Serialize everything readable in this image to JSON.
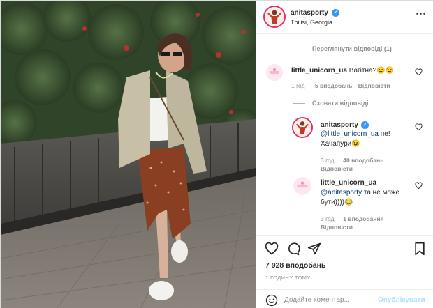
{
  "header": {
    "username": "anitasporty",
    "location": "Tbilisi, Georgia"
  },
  "comments": {
    "view_replies": "Переглянути відповіді (1)",
    "hide_replies": "Сховати відповіді",
    "items": [
      {
        "username": "little_unicorn_ua",
        "text": "Вагітна?😉😉",
        "time": "1 год",
        "likes": "5 вподобань",
        "reply": "Відповісти"
      },
      {
        "username": "anitasporty",
        "mention": "@little_unicorn_ua",
        "text_line1": "не!",
        "text_line2": "Хачапури😉",
        "time": "3 год.",
        "likes": "40 вподобань",
        "reply": "Відповісти"
      },
      {
        "username": "little_unicorn_ua",
        "mention": "@anitasporty",
        "text_line1": "та не може",
        "text_line2": "бути))))😂",
        "time": "3 год.",
        "likes": "1 вподобання",
        "reply": "Відповісти"
      }
    ]
  },
  "actions": {
    "likes": "7 928 вподобань",
    "timestamp": "1 ГОДИНУ ТОМУ"
  },
  "add_comment": {
    "placeholder": "Додайте коментар...",
    "post_label": "Опублікувати"
  },
  "icons": [
    "more-icon",
    "heart-icon",
    "comment-icon",
    "share-icon",
    "bookmark-icon",
    "emoji-icon",
    "verified-icon"
  ],
  "colors": {
    "verified": "#3897f0",
    "link": "#00376b",
    "muted": "#8e8e8e",
    "post_button": "#b2dffc",
    "story_ring": "#e1306c"
  }
}
